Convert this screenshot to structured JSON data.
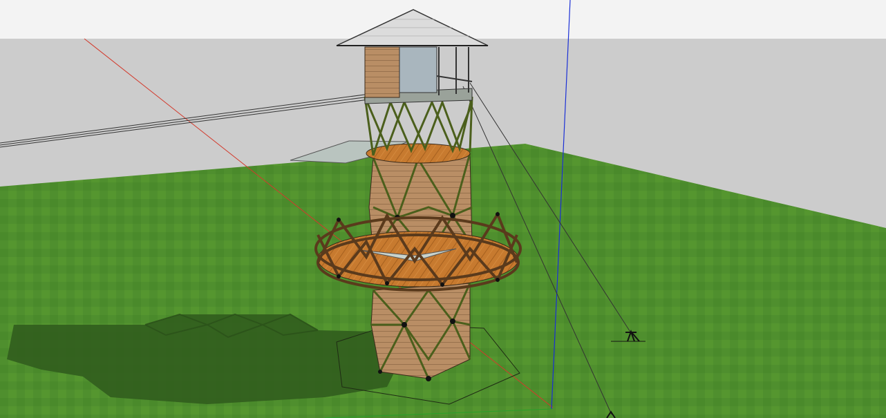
{
  "viewport": {
    "sky_color": "#f2f2f2",
    "horizon_color": "#cfcfcf",
    "ground_color": "#4f8f2e",
    "ground_dark": "#3f7a24",
    "wood_color": "#b98e65",
    "wood_dark": "#8f6a47",
    "deck_color": "#c87a2e",
    "frame_color": "#556b1f",
    "roof_color": "#dcdcdc",
    "axis_red": "#d33a2c",
    "axis_blue": "#1a2fd6",
    "axis_green": "#2aa02a"
  },
  "icons": [
    "tripod-anchor-icon"
  ]
}
